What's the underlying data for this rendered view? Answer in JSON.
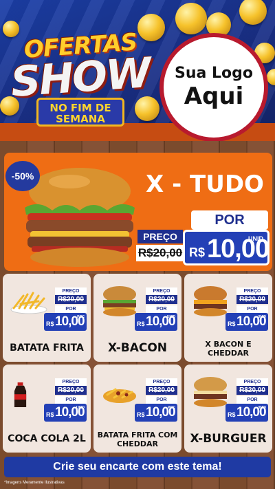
{
  "header": {
    "title_line1": "OFERTAS",
    "title_line2": "SHOW",
    "badge": "NO FIM DE SEMANA",
    "logo_line1": "Sua Logo",
    "logo_line2": "Aqui"
  },
  "featured": {
    "discount": "-50%",
    "name": "X - TUDO",
    "preco_label": "PREÇO",
    "old_price": "R$20,00",
    "por_label": "POR",
    "currency": "R$",
    "new_price": "10,00",
    "unid_label": "UNID"
  },
  "products": [
    {
      "name": "BATATA FRITA",
      "preco_label": "PREÇO",
      "old_price": "R$20,00",
      "por_label": "POR",
      "currency": "R$",
      "new_price": "10,00",
      "unid_label": "POÇ"
    },
    {
      "name": "X-BACON",
      "preco_label": "PREÇO",
      "old_price": "R$20,00",
      "por_label": "POR",
      "currency": "R$",
      "new_price": "10,00",
      "unid_label": "UNID"
    },
    {
      "name": "X BACON E CHEDDAR",
      "preco_label": "PREÇO",
      "old_price": "R$20,00",
      "por_label": "POR",
      "currency": "R$",
      "new_price": "10,00",
      "unid_label": "UNID"
    },
    {
      "name": "COCA COLA 2L",
      "preco_label": "PREÇO",
      "old_price": "R$20,00",
      "por_label": "POR",
      "currency": "R$",
      "new_price": "10,00",
      "unid_label": "UNID"
    },
    {
      "name": "BATATA FRITA COM CHEDDAR",
      "preco_label": "PREÇO",
      "old_price": "R$20,00",
      "por_label": "POR",
      "currency": "R$",
      "new_price": "10,00",
      "unid_label": "POÇ"
    },
    {
      "name": "X-BURGUER",
      "preco_label": "PREÇO",
      "old_price": "R$20,00",
      "por_label": "POR",
      "currency": "R$",
      "new_price": "10,00",
      "unid_label": "UNID"
    }
  ],
  "cta": "Crie seu encarte com este tema!",
  "footnote": "*Imagens Meramente Ilustrativas"
}
